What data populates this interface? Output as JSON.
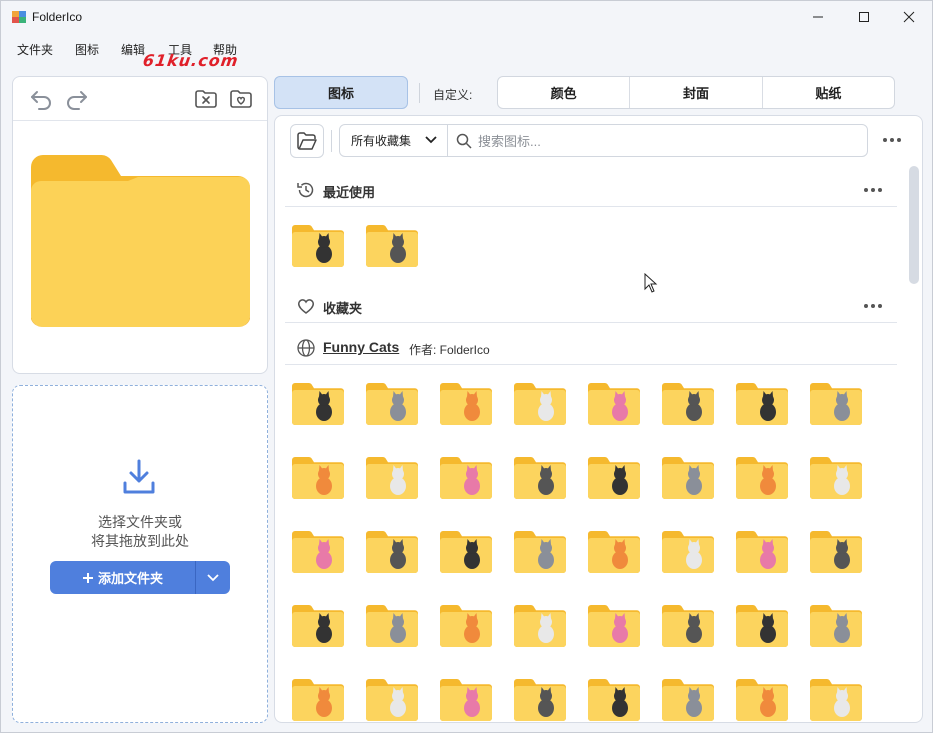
{
  "app": {
    "title": "FolderIco",
    "logo_icon": "app-logo-icon"
  },
  "window_controls": {
    "minimize_icon": "minimize-icon",
    "maximize_icon": "maximize-icon",
    "close_icon": "close-icon"
  },
  "menu": {
    "items": [
      "文件夹",
      "图标",
      "编辑",
      "工具",
      "帮助"
    ]
  },
  "watermark": "61ku.com",
  "preview": {
    "undo_icon": "undo-icon",
    "redo_icon": "redo-icon",
    "clear_icon": "folder-remove-icon",
    "favorite_icon": "folder-heart-icon",
    "folder_color": "#fbcd4b"
  },
  "dropzone": {
    "line1": "选择文件夹或",
    "line2": "将其拖放到此处",
    "add_button_label": "添加文件夹",
    "accent": "#4f7fdd"
  },
  "tabs": {
    "icons_label": "图标",
    "custom_label": "自定义:",
    "custom_items": [
      "颜色",
      "封面",
      "贴纸"
    ]
  },
  "toolbar": {
    "collection_selected": "所有收藏集",
    "search_placeholder": "搜索图标..."
  },
  "sections": {
    "recent": {
      "title": "最近使用"
    },
    "favorites": {
      "title": "收藏夹"
    },
    "pack": {
      "name": "Funny Cats",
      "author": "作者: FolderIco"
    }
  },
  "recent_icons": [
    "cat-pink-folder-icon",
    "cat-black-folder-icon"
  ],
  "pack_icons": [
    [
      "cat-black-sitting-icon",
      "cat-gray-robot-icon",
      "cat-black-jumping-icon",
      "cat-gray-tree-icon",
      "cat-house-icon",
      "cat-box-icon",
      "cat-orange-ball-icon",
      "cat-basket-icon"
    ],
    [
      "cat-gray-lying-icon",
      "cat-white-icon",
      "cat-tree-orange-icon",
      "cat-pink-icon",
      "cat-ghost-icon",
      "cat-orange-sitting-icon",
      "cat-tabby-icon",
      "cat-fishbowl-icon"
    ],
    [
      "cat-tree-gray-icon",
      "cat-orange-sleeping-icon",
      "cat-hearts-icon",
      "cat-fridge-icon",
      "cat-sheet-ghost-icon",
      "cat-gift-box-icon",
      "cat-gray-fat-icon",
      "cat-black-angry-icon"
    ],
    [
      "cat-orange-bowl-icon",
      "cat-chef-icon",
      "cat-laptop-icon",
      "cat-tree-black-icon",
      "cat-tree-white-icon",
      "cat-gray-tea-icon",
      "cat-white-sleeping-icon",
      "cat-gray-white-icon"
    ],
    [
      "cat-tree-black-small-icon",
      "cat-orange-walking-icon",
      "cat-black-bowl-icon",
      "cat-pumpkin-icon",
      "cat-gray-sitting-icon",
      "cat-tree-tabby-icon",
      "cat-white-carrot-icon",
      "cat-orange-fat-icon"
    ]
  ]
}
